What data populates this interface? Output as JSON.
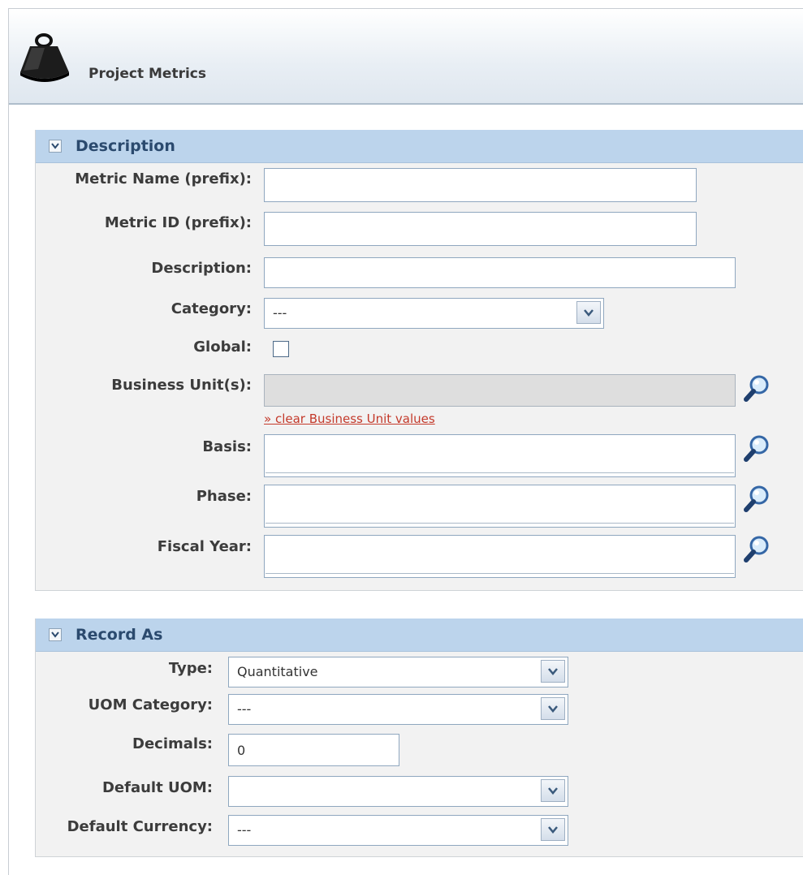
{
  "header": {
    "title": "Project Metrics",
    "icon": "weight-icon"
  },
  "description_panel": {
    "title": "Description",
    "metric_name": {
      "label": "Metric Name (prefix):",
      "value": ""
    },
    "metric_id": {
      "label": "Metric ID (prefix):",
      "value": ""
    },
    "description": {
      "label": "Description:",
      "value": ""
    },
    "category": {
      "label": "Category:",
      "value": "---"
    },
    "global": {
      "label": "Global:",
      "checked": false
    },
    "business_units": {
      "label": "Business Unit(s):",
      "value": "",
      "clear_link": "» clear Business Unit values"
    },
    "basis": {
      "label": "Basis:",
      "value": ""
    },
    "phase": {
      "label": "Phase:",
      "value": ""
    },
    "fiscal_year": {
      "label": "Fiscal Year:",
      "value": ""
    }
  },
  "record_as_panel": {
    "title": "Record As",
    "type": {
      "label": "Type:",
      "value": "Quantitative"
    },
    "uom_category": {
      "label": "UOM Category:",
      "value": "---"
    },
    "decimals": {
      "label": "Decimals:",
      "value": "0"
    },
    "default_uom": {
      "label": "Default UOM:",
      "value": ""
    },
    "default_currency": {
      "label": "Default Currency:",
      "value": "---"
    }
  },
  "colors": {
    "panel_header": "#bcd4ec",
    "panel_title": "#2b4a6e",
    "link": "#c43a2b",
    "panel_bg": "#f2f2f2"
  }
}
